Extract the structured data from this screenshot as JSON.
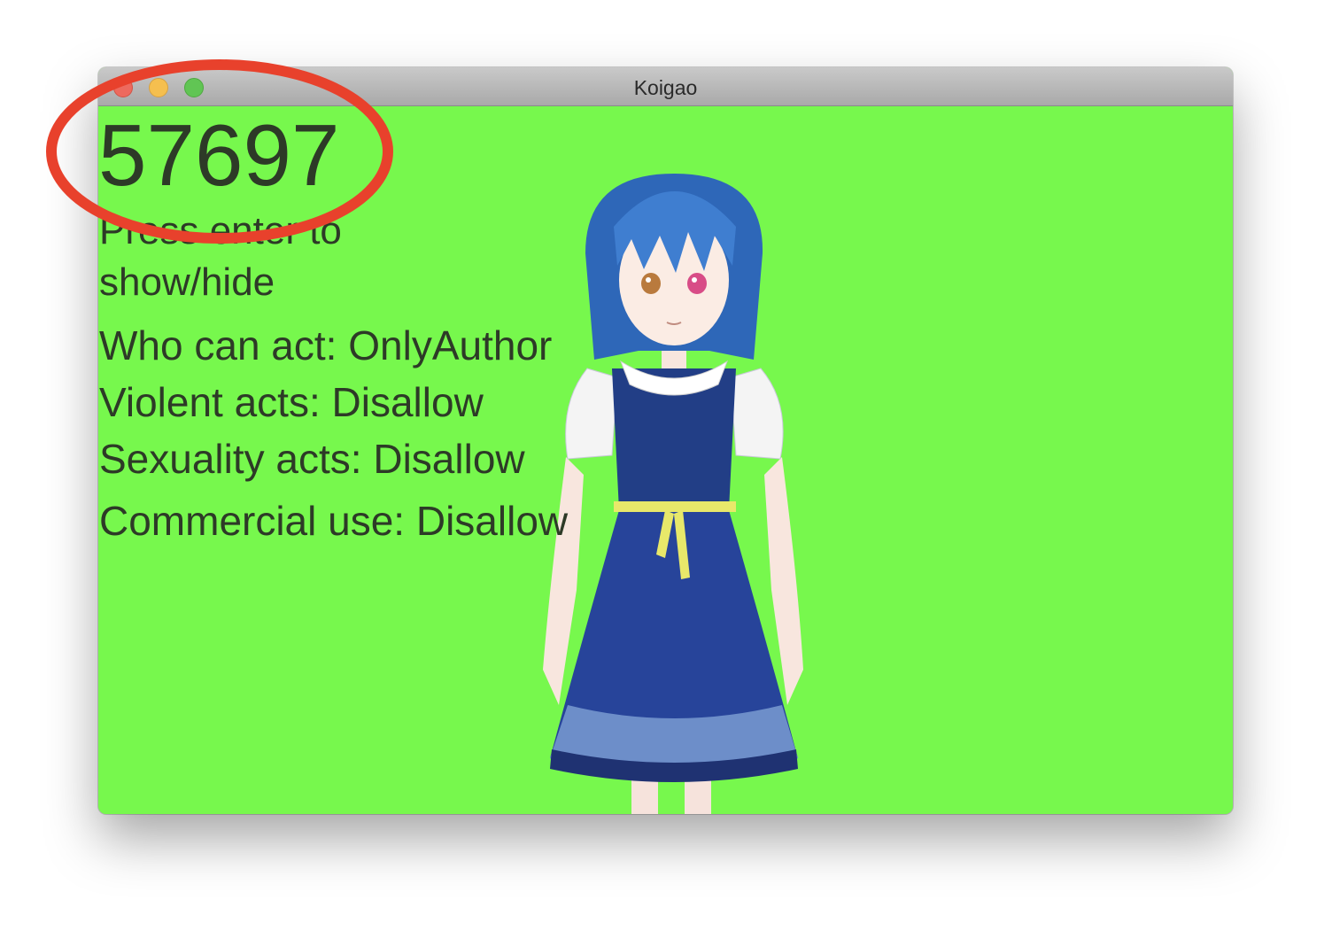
{
  "window": {
    "title": "Koigao",
    "background_color": "#77f84d",
    "controls": [
      "close-icon",
      "minimize-icon",
      "maximize-icon"
    ]
  },
  "overlay": {
    "counter": "57697",
    "hint": "Press enter to show/hide",
    "info": [
      "Who can act: OnlyAuthor",
      "Violent acts: Disallow",
      "Sexuality acts: Disallow",
      "Commercial use: Disallow"
    ]
  },
  "character": {
    "hair_color": "#3f7ed0",
    "dress_color": "#1f3a86",
    "ribbon_color": "#e8e86a"
  },
  "annotation": {
    "color": "#e8412c"
  }
}
